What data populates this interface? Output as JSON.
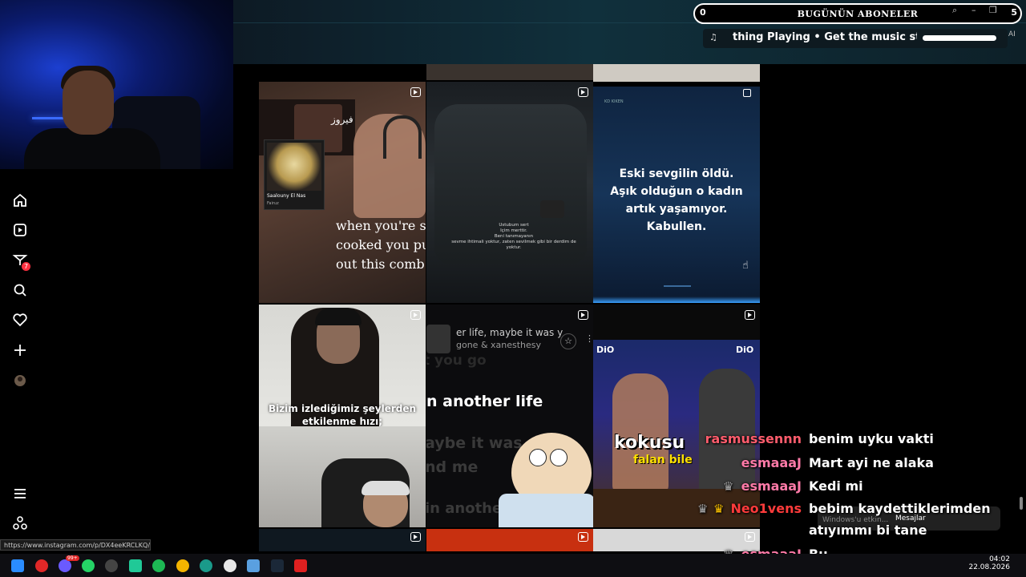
{
  "overlay": {
    "subscribers": {
      "count": "0",
      "title": "BUGÜNÜN ABONELER",
      "end": "5"
    },
    "now_playing": {
      "text": "thing Playing  •  Get the music sto"
    },
    "ai_label": "AI"
  },
  "grid": {
    "tile1": {
      "album_title": "Saalouny El Nas",
      "album_artist": "Fairuz",
      "arabic_text": "فيروز",
      "caption_lines": [
        "when you're s",
        "cooked you pu",
        "out this comb"
      ]
    },
    "tile2": {
      "caption_lines": [
        "Ustubum sert",
        "Içim merttir.",
        "Beni tanımayanın",
        "sevme ihtimali yoktur, zaten sevilmek gibi bir derdim de",
        "yoktur."
      ]
    },
    "tile3": {
      "header_left": "KD KIKEN",
      "caption_lines": [
        "Eski sevgilin öldü.",
        "Aşık olduğun o kadın",
        "artık yaşamıyor.",
        "Kabullen."
      ]
    },
    "tile4": {
      "caption_lines": [
        "Bizim izlediğimiz şeylerden",
        "etkilenme hızı;"
      ]
    },
    "tile5": {
      "lyric1": "er life, maybe it was y",
      "credit": "gone & xanesthesy",
      "lyric_faded": "t you go",
      "lyric2": "n another life",
      "lyric3": "aybe it was",
      "lyric4": "nd me",
      "lyric5": "in anothe"
    },
    "tile6": {
      "brand": "DiO",
      "word1": "kokusu",
      "word2": "falan bile"
    }
  },
  "chat": [
    {
      "user": "rasmussennn",
      "msg": "benim uyku vakti",
      "color": "#ff5c6c"
    },
    {
      "user": "esmaaaJ",
      "msg": "Mart ayi ne alaka",
      "color": "#ff7aa8"
    },
    {
      "user": "esmaaaJ",
      "msg": "Kedi mi",
      "color": "#ff7aa8"
    },
    {
      "user": "Neo1vens",
      "msg": "bebim kaydettiklerimden",
      "color": "#ff3b3b"
    },
    {
      "user": "",
      "msg": "atıyımmı bi tane",
      "color": "#ffffff"
    },
    {
      "user": "esmaaaJ",
      "msg": "Bu",
      "color": "#ff7aa8"
    }
  ],
  "notification": {
    "text": "Mesajlar",
    "faded": "Windows'u etkin..."
  },
  "status_url": "https://www.instagram.com/p/DX4eeKRCLKQ/",
  "nav": {
    "items": [
      "home-icon",
      "reels-icon",
      "messages-icon",
      "search-icon",
      "notifications-icon",
      "create-icon",
      "profile-avatar"
    ],
    "badge": "7",
    "more": "menu-icon",
    "apps": "apps-icon"
  },
  "taskbar": {
    "time": "04:02",
    "date": "22.08.2026",
    "badge1": "99+"
  }
}
